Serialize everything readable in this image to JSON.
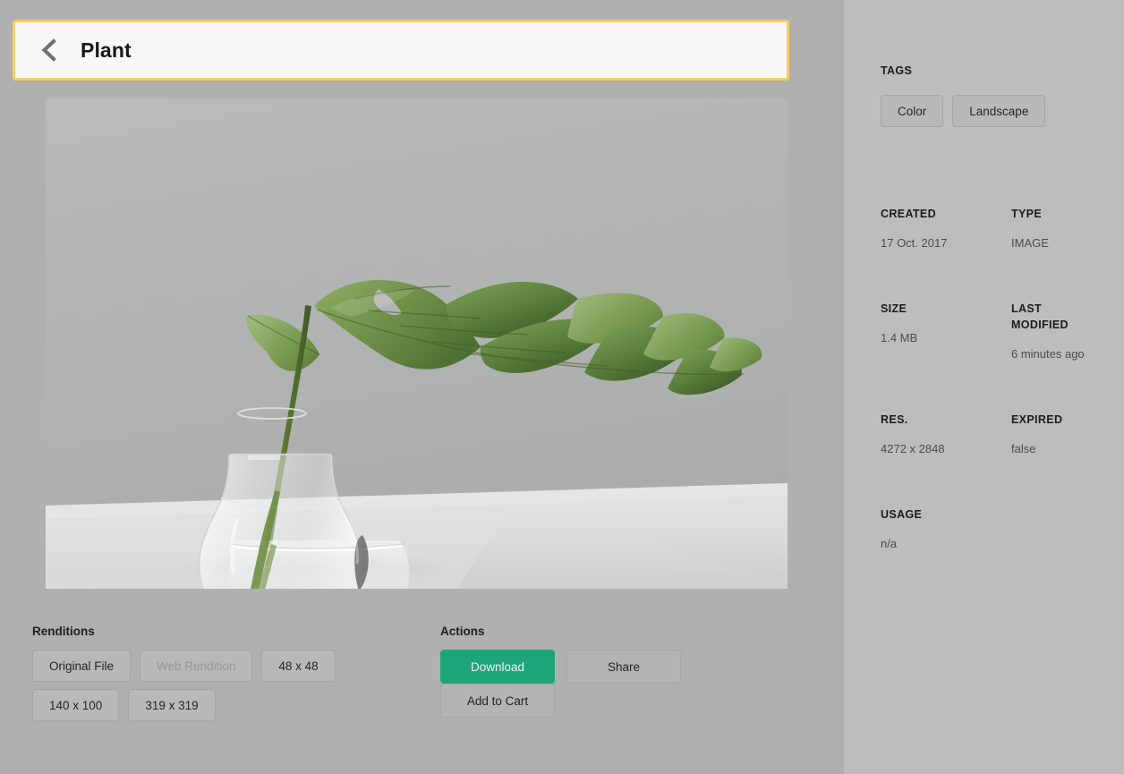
{
  "header": {
    "back_icon": "chevron-left-icon",
    "title": "Plant"
  },
  "preview": {
    "alt": "plant-photo",
    "description": "Monstera leaf in a clear glass vase on a white surface"
  },
  "renditions": {
    "heading": "Renditions",
    "buttons": [
      {
        "label": "Original File",
        "disabled": false
      },
      {
        "label": "Web Rendition",
        "disabled": true
      },
      {
        "label": "48 x 48",
        "disabled": false
      },
      {
        "label": "140 x 100",
        "disabled": false
      },
      {
        "label": "319 x 319",
        "disabled": false
      }
    ]
  },
  "actions": {
    "heading": "Actions",
    "buttons": [
      {
        "label": "Download",
        "style": "primary"
      },
      {
        "label": "Share",
        "style": "secondary"
      },
      {
        "label": "Add to Cart",
        "style": "secondary"
      }
    ]
  },
  "sidebar": {
    "tags": {
      "label": "TAGS",
      "items": [
        {
          "label": "Color"
        },
        {
          "label": "Landscape"
        }
      ]
    },
    "metadata": {
      "created": {
        "label": "CREATED",
        "value": "17 Oct. 2017"
      },
      "type": {
        "label": "TYPE",
        "value": "IMAGE"
      },
      "size": {
        "label": "SIZE",
        "value": "1.4 MB"
      },
      "last_modified": {
        "label": "LAST MODIFIED",
        "value": "6 minutes ago"
      },
      "resolution": {
        "label": "RES.",
        "value": "4272 x 2848"
      },
      "expired": {
        "label": "EXPIRED",
        "value": "false"
      },
      "usage": {
        "label": "USAGE",
        "value": "n/a"
      }
    }
  },
  "colors": {
    "page_background": "#bcbcbc",
    "main_background": "#b0b0b0",
    "sidebar_background": "#bdbdbd",
    "header_background": "#f8f8f8",
    "focus_ring": "#f6ce63",
    "primary_action": "#1ea47b",
    "secondary_action": "#b4b4b4",
    "chip_background": "#b9b9b9",
    "chip_border": "#a6a6a6"
  }
}
